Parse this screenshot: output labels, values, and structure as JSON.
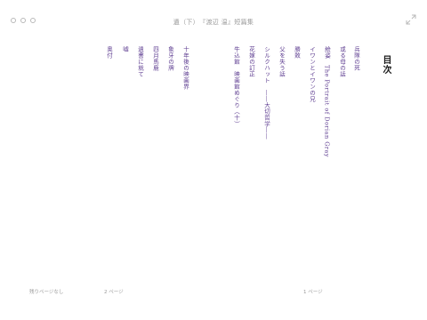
{
  "window": {
    "title": "遺（下）　『渡辺 温』短篇集"
  },
  "icons": {
    "window_controls": [
      "close-icon",
      "minimize-icon",
      "zoom-icon"
    ],
    "fullscreen": "expand-arrows-icon"
  },
  "toc": {
    "heading": "目次",
    "items": [
      {
        "label": "兵隊の死"
      },
      {
        "label": "或る母の話"
      },
      {
        "label": "絵姿　The Portrait of Dorian Gray"
      },
      {
        "label": "イワンとイワンの兄"
      },
      {
        "label": "勝敗"
      },
      {
        "label": "父を失う話"
      },
      {
        "label": "シルクハット　――大切哲学――"
      },
      {
        "label": "花嫁の訂正"
      },
      {
        "label": "牛込館　映画館めぐり（十）"
      },
      {
        "label": "十年後の映画界"
      },
      {
        "label": "象牙の牌"
      },
      {
        "label": "四月馬鹿"
      },
      {
        "label": "遺書に就て"
      },
      {
        "label": "嘘"
      },
      {
        "label": "奥付"
      }
    ]
  },
  "footer": {
    "left_status": "残りページなし",
    "left_page": "2 ページ",
    "right_page": "1 ページ"
  },
  "colors": {
    "link": "#5b3a8f",
    "heading": "#1a1a1a",
    "chrome_text": "#9a9a9a"
  }
}
